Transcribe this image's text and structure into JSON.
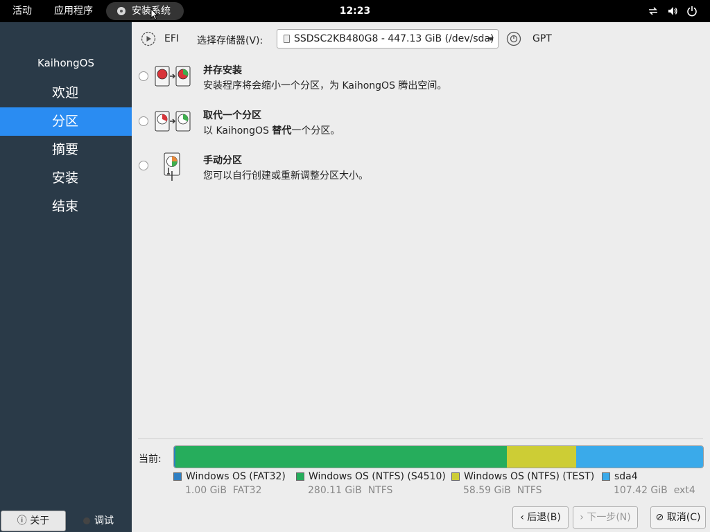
{
  "topbar": {
    "activities": "活动",
    "applications": "应用程序",
    "app_name": "安装系统",
    "clock": "12:23",
    "icons": [
      "network-icon",
      "volume-icon",
      "power-icon"
    ]
  },
  "sidebar": {
    "logo": "KaihongOS",
    "steps": [
      {
        "label": "欢迎"
      },
      {
        "label": "分区"
      },
      {
        "label": "摘要"
      },
      {
        "label": "安装"
      },
      {
        "label": "结束"
      }
    ],
    "active_step": 1,
    "about_label": "关于",
    "debug_label": "调试"
  },
  "storage": {
    "efi_label": "EFI",
    "select_label": "选择存储器(V):",
    "device_value": "SSDSC2KB480G8 - 447.13 GiB (/dev/sda)",
    "table_label": "GPT"
  },
  "options": [
    {
      "title": "并存安装",
      "desc": "安装程序将会缩小一个分区，为 KaihongOS 腾出空间。"
    },
    {
      "title": "取代一个分区",
      "desc_pre": "以 KaihongOS ",
      "desc_bold": "替代",
      "desc_post": "一个分区。"
    },
    {
      "title": "手动分区",
      "desc": "您可以自行创建或重新调整分区大小。"
    }
  ],
  "current": {
    "label": "当前:",
    "partitions": [
      {
        "name": "Windows OS (FAT32)",
        "size": "1.00 GiB",
        "fs": "FAT32",
        "color": "#2f7fc2",
        "gib": 1.0
      },
      {
        "name": "Windows OS (NTFS) (S4510)",
        "size": "280.11 GiB",
        "fs": "NTFS",
        "color": "#26ad5c",
        "gib": 280.11
      },
      {
        "name": "Windows OS (NTFS) (TEST)",
        "size": "58.59 GiB",
        "fs": "NTFS",
        "color": "#cdcd35",
        "gib": 58.59
      },
      {
        "name": "sda4",
        "size": "107.42 GiB",
        "fs": "ext4",
        "color": "#3aaaea",
        "gib": 107.42
      }
    ]
  },
  "buttons": {
    "back": "后退(B)",
    "next": "下一步(N)",
    "cancel": "取消(C)"
  }
}
